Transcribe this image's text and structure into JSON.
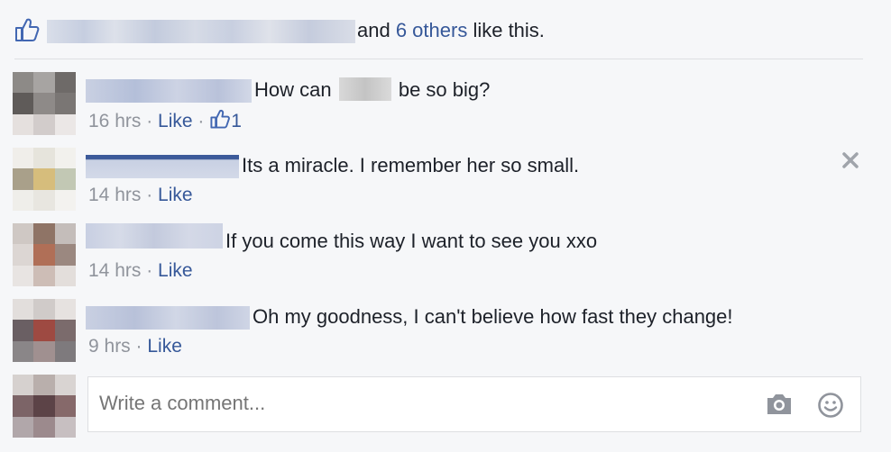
{
  "likes": {
    "and_text": "and ",
    "others_link": "6 others",
    "suffix": " like this."
  },
  "comments": [
    {
      "text_before": "How can ",
      "text_after": " be so big?",
      "time": "16 hrs",
      "sep": " · ",
      "like_label": "Like",
      "like_count": "1"
    },
    {
      "text": "Its a miracle. I remember her so small.",
      "time": "14 hrs",
      "sep": " · ",
      "like_label": "Like"
    },
    {
      "text": "If you come this way I want to see you xxo",
      "time": "14 hrs",
      "sep": " · ",
      "like_label": "Like"
    },
    {
      "text": "Oh my goodness, I can't believe how fast they change!",
      "time": "9 hrs",
      "sep": " · ",
      "like_label": "Like"
    }
  ],
  "composer": {
    "placeholder": "Write a comment..."
  },
  "icons": {
    "like": "thumbs-up-icon",
    "close": "close-icon",
    "camera": "camera-icon",
    "emoji": "smiley-icon"
  },
  "colors": {
    "link": "#365899",
    "meta": "#90949c",
    "text": "#1d2129",
    "background": "#f6f7f9"
  }
}
